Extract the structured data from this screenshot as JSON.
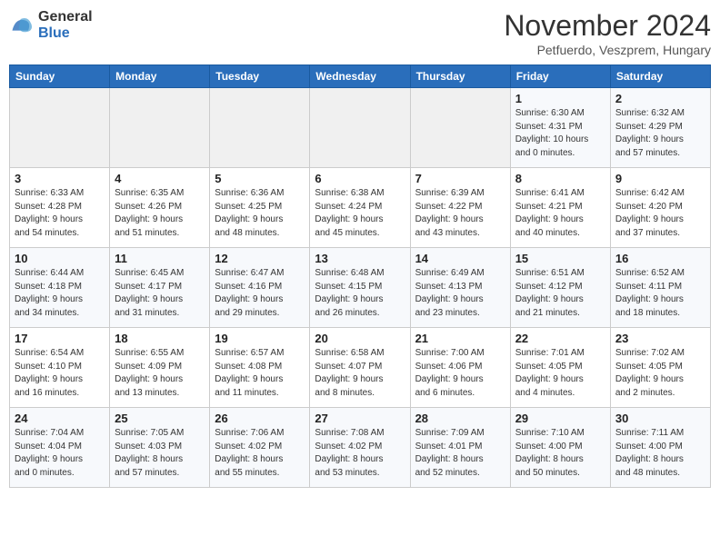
{
  "header": {
    "logo_general": "General",
    "logo_blue": "Blue",
    "month": "November 2024",
    "location": "Petfuerdo, Veszprem, Hungary"
  },
  "weekdays": [
    "Sunday",
    "Monday",
    "Tuesday",
    "Wednesday",
    "Thursday",
    "Friday",
    "Saturday"
  ],
  "weeks": [
    [
      {
        "day": "",
        "info": ""
      },
      {
        "day": "",
        "info": ""
      },
      {
        "day": "",
        "info": ""
      },
      {
        "day": "",
        "info": ""
      },
      {
        "day": "",
        "info": ""
      },
      {
        "day": "1",
        "info": "Sunrise: 6:30 AM\nSunset: 4:31 PM\nDaylight: 10 hours\nand 0 minutes."
      },
      {
        "day": "2",
        "info": "Sunrise: 6:32 AM\nSunset: 4:29 PM\nDaylight: 9 hours\nand 57 minutes."
      }
    ],
    [
      {
        "day": "3",
        "info": "Sunrise: 6:33 AM\nSunset: 4:28 PM\nDaylight: 9 hours\nand 54 minutes."
      },
      {
        "day": "4",
        "info": "Sunrise: 6:35 AM\nSunset: 4:26 PM\nDaylight: 9 hours\nand 51 minutes."
      },
      {
        "day": "5",
        "info": "Sunrise: 6:36 AM\nSunset: 4:25 PM\nDaylight: 9 hours\nand 48 minutes."
      },
      {
        "day": "6",
        "info": "Sunrise: 6:38 AM\nSunset: 4:24 PM\nDaylight: 9 hours\nand 45 minutes."
      },
      {
        "day": "7",
        "info": "Sunrise: 6:39 AM\nSunset: 4:22 PM\nDaylight: 9 hours\nand 43 minutes."
      },
      {
        "day": "8",
        "info": "Sunrise: 6:41 AM\nSunset: 4:21 PM\nDaylight: 9 hours\nand 40 minutes."
      },
      {
        "day": "9",
        "info": "Sunrise: 6:42 AM\nSunset: 4:20 PM\nDaylight: 9 hours\nand 37 minutes."
      }
    ],
    [
      {
        "day": "10",
        "info": "Sunrise: 6:44 AM\nSunset: 4:18 PM\nDaylight: 9 hours\nand 34 minutes."
      },
      {
        "day": "11",
        "info": "Sunrise: 6:45 AM\nSunset: 4:17 PM\nDaylight: 9 hours\nand 31 minutes."
      },
      {
        "day": "12",
        "info": "Sunrise: 6:47 AM\nSunset: 4:16 PM\nDaylight: 9 hours\nand 29 minutes."
      },
      {
        "day": "13",
        "info": "Sunrise: 6:48 AM\nSunset: 4:15 PM\nDaylight: 9 hours\nand 26 minutes."
      },
      {
        "day": "14",
        "info": "Sunrise: 6:49 AM\nSunset: 4:13 PM\nDaylight: 9 hours\nand 23 minutes."
      },
      {
        "day": "15",
        "info": "Sunrise: 6:51 AM\nSunset: 4:12 PM\nDaylight: 9 hours\nand 21 minutes."
      },
      {
        "day": "16",
        "info": "Sunrise: 6:52 AM\nSunset: 4:11 PM\nDaylight: 9 hours\nand 18 minutes."
      }
    ],
    [
      {
        "day": "17",
        "info": "Sunrise: 6:54 AM\nSunset: 4:10 PM\nDaylight: 9 hours\nand 16 minutes."
      },
      {
        "day": "18",
        "info": "Sunrise: 6:55 AM\nSunset: 4:09 PM\nDaylight: 9 hours\nand 13 minutes."
      },
      {
        "day": "19",
        "info": "Sunrise: 6:57 AM\nSunset: 4:08 PM\nDaylight: 9 hours\nand 11 minutes."
      },
      {
        "day": "20",
        "info": "Sunrise: 6:58 AM\nSunset: 4:07 PM\nDaylight: 9 hours\nand 8 minutes."
      },
      {
        "day": "21",
        "info": "Sunrise: 7:00 AM\nSunset: 4:06 PM\nDaylight: 9 hours\nand 6 minutes."
      },
      {
        "day": "22",
        "info": "Sunrise: 7:01 AM\nSunset: 4:05 PM\nDaylight: 9 hours\nand 4 minutes."
      },
      {
        "day": "23",
        "info": "Sunrise: 7:02 AM\nSunset: 4:05 PM\nDaylight: 9 hours\nand 2 minutes."
      }
    ],
    [
      {
        "day": "24",
        "info": "Sunrise: 7:04 AM\nSunset: 4:04 PM\nDaylight: 9 hours\nand 0 minutes."
      },
      {
        "day": "25",
        "info": "Sunrise: 7:05 AM\nSunset: 4:03 PM\nDaylight: 8 hours\nand 57 minutes."
      },
      {
        "day": "26",
        "info": "Sunrise: 7:06 AM\nSunset: 4:02 PM\nDaylight: 8 hours\nand 55 minutes."
      },
      {
        "day": "27",
        "info": "Sunrise: 7:08 AM\nSunset: 4:02 PM\nDaylight: 8 hours\nand 53 minutes."
      },
      {
        "day": "28",
        "info": "Sunrise: 7:09 AM\nSunset: 4:01 PM\nDaylight: 8 hours\nand 52 minutes."
      },
      {
        "day": "29",
        "info": "Sunrise: 7:10 AM\nSunset: 4:00 PM\nDaylight: 8 hours\nand 50 minutes."
      },
      {
        "day": "30",
        "info": "Sunrise: 7:11 AM\nSunset: 4:00 PM\nDaylight: 8 hours\nand 48 minutes."
      }
    ]
  ]
}
